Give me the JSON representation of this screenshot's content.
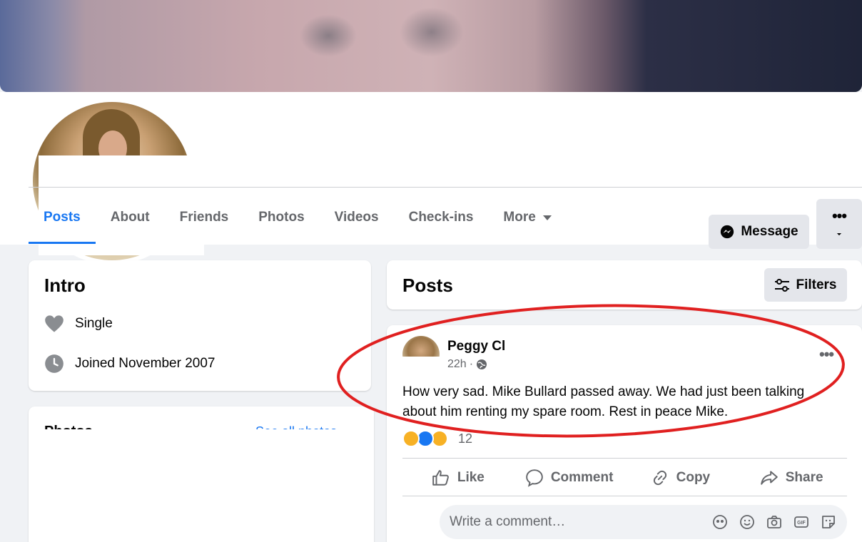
{
  "profile": {
    "message_label": "Message"
  },
  "tabs": [
    {
      "label": "Posts",
      "active": true
    },
    {
      "label": "About"
    },
    {
      "label": "Friends"
    },
    {
      "label": "Photos"
    },
    {
      "label": "Videos"
    },
    {
      "label": "Check-ins"
    },
    {
      "label": "More"
    }
  ],
  "intro": {
    "title": "Intro",
    "relationship": "Single",
    "joined": "Joined November 2007"
  },
  "photos_card": {
    "title": "Photos",
    "see_all": "See all photos"
  },
  "posts_section": {
    "title": "Posts",
    "filters_label": "Filters"
  },
  "post": {
    "author": "Peggy Cl",
    "time": "22h",
    "text": "How very sad.  Mike Bullard passed away.  We had just been talking about him renting my spare room.  Rest in peace Mike.",
    "reaction_count": "12",
    "actions": {
      "like": "Like",
      "comment": "Comment",
      "copy": "Copy",
      "share": "Share"
    },
    "comment_placeholder": "Write a comment…"
  },
  "colors": {
    "accent": "#1877f2",
    "annotation": "#e02020"
  }
}
